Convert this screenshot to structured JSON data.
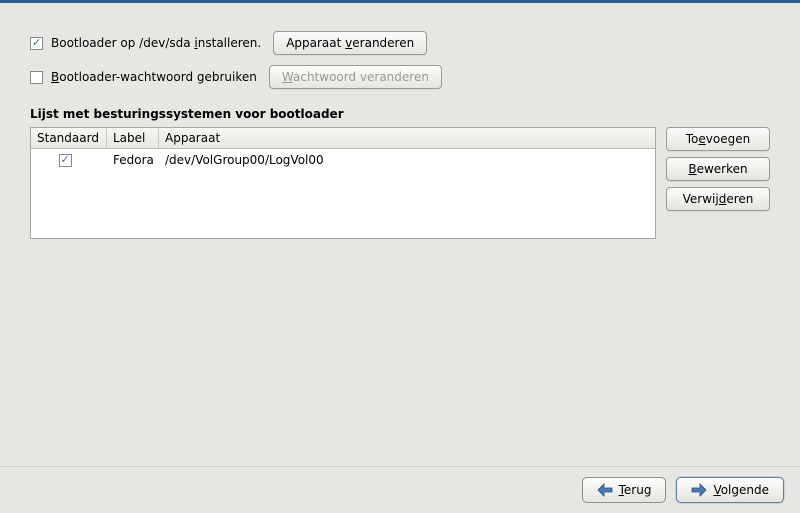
{
  "install_checkbox": {
    "checked": true,
    "label_pre": "Bootloader op /dev/sda ",
    "label_u": "i",
    "label_post": "nstalleren."
  },
  "change_device_btn": {
    "label_pre": "Apparaat ",
    "label_u": "v",
    "label_post": "eranderen"
  },
  "password_checkbox": {
    "checked": false,
    "label_u": "B",
    "label_post": "ootloader-wachtwoord gebruiken"
  },
  "change_password_btn": {
    "label_pre": "",
    "label_u": "W",
    "label_post": "achtwoord veranderen",
    "disabled": true
  },
  "list_heading": "Lijst met besturingssystemen voor bootloader",
  "columns": {
    "std": "Standaard",
    "label": "Label",
    "device": "Apparaat"
  },
  "rows": [
    {
      "std_checked": true,
      "label": "Fedora",
      "device": "/dev/VolGroup00/LogVol00"
    }
  ],
  "side": {
    "add_pre": "To",
    "add_u": "e",
    "add_post": "voegen",
    "edit_u": "B",
    "edit_post": "ewerken",
    "del_pre": "Verwij",
    "del_u": "d",
    "del_post": "eren"
  },
  "footer": {
    "back_u": "T",
    "back_post": "erug",
    "next_u": "V",
    "next_post": "olgende"
  }
}
